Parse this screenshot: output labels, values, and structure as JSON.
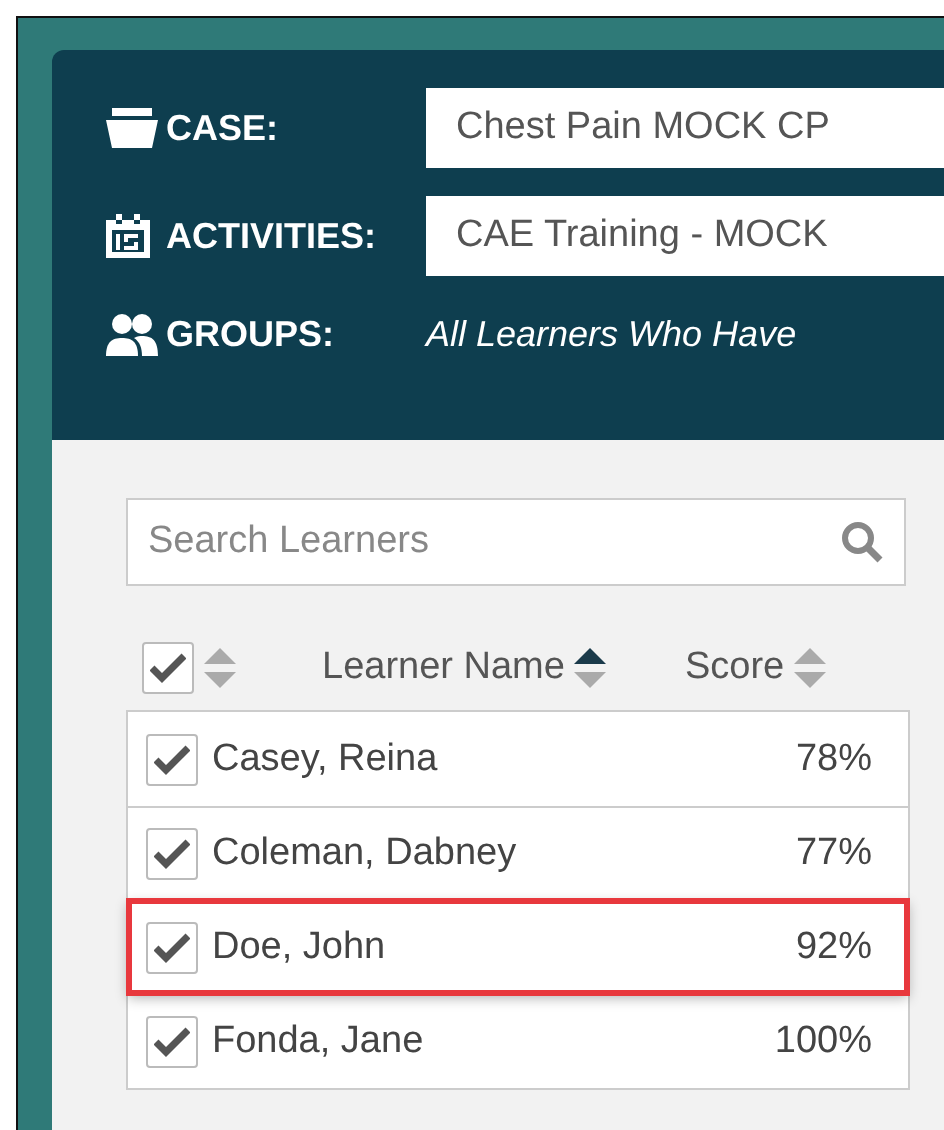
{
  "filters": [
    {
      "kind": "case",
      "label": "CASE:",
      "value": "Chest Pain MOCK CP"
    },
    {
      "kind": "activities",
      "label": "ACTIVITIES:",
      "value": "CAE Training - MOCK"
    },
    {
      "kind": "groups",
      "label": "GROUPS:",
      "value": "All Learners Who Have"
    }
  ],
  "search": {
    "placeholder": "Search Learners"
  },
  "table": {
    "select_all": {
      "checked": true
    },
    "columns": [
      {
        "label": "Learner Name",
        "sorted": true
      },
      {
        "label": "Score",
        "sorted": false
      }
    ],
    "rows": [
      {
        "name": "Casey, Reina",
        "score": "78%",
        "checked": true,
        "highlighted": false
      },
      {
        "name": "Coleman, Dabney",
        "score": "77%",
        "checked": true,
        "highlighted": false
      },
      {
        "name": "Doe, John",
        "score": "92%",
        "checked": true,
        "highlighted": true
      },
      {
        "name": "Fonda, Jane",
        "score": "100%",
        "checked": true,
        "highlighted": false
      }
    ]
  }
}
